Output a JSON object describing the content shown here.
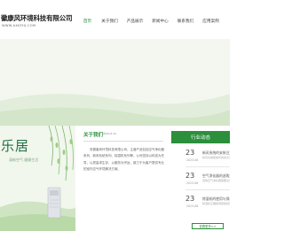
{
  "header": {
    "company": "徽康风环境科技有限公司",
    "url": "WWW.AXKFHJ.COM"
  },
  "nav": {
    "items": [
      "首页",
      "关于我们",
      "产品展示",
      "新闻中心",
      "联系我们",
      "应用案例"
    ],
    "active_index": 0
  },
  "about": {
    "title": "关于我们",
    "subtitle": "About us",
    "body": "安徽康风环境科技有限公司，主营产品包括空气净化器系列、新风系统系列、除湿机系列等。公司坚持以科技为先导，以质量求生存，以服务为宗旨，致力于为客户提供专业的室内空气环境解决方案。"
  },
  "banner": {
    "title": "乐居",
    "subtitle": "清新空气 健康生活"
  },
  "news": {
    "title": "行业动态",
    "more_label": "查看更多>>",
    "items": [
      {
        "day": "23",
        "ym": "2023-08",
        "headline": "新风系统的安装注意事项",
        "desc": "新风系统能够有效改善室内空气质量..."
      },
      {
        "day": "23",
        "ym": "2023-08",
        "headline": "空气净化器的选购方法",
        "desc": "选购空气净化器需要注意的几个要点..."
      },
      {
        "day": "23",
        "ym": "2023-08",
        "headline": "除湿机的使用与保养",
        "desc": "除湿机正确使用能够延长使用寿命..."
      }
    ]
  },
  "colors": {
    "accent": "#2b8f3c",
    "banner_bg": "#f3f7ef"
  }
}
